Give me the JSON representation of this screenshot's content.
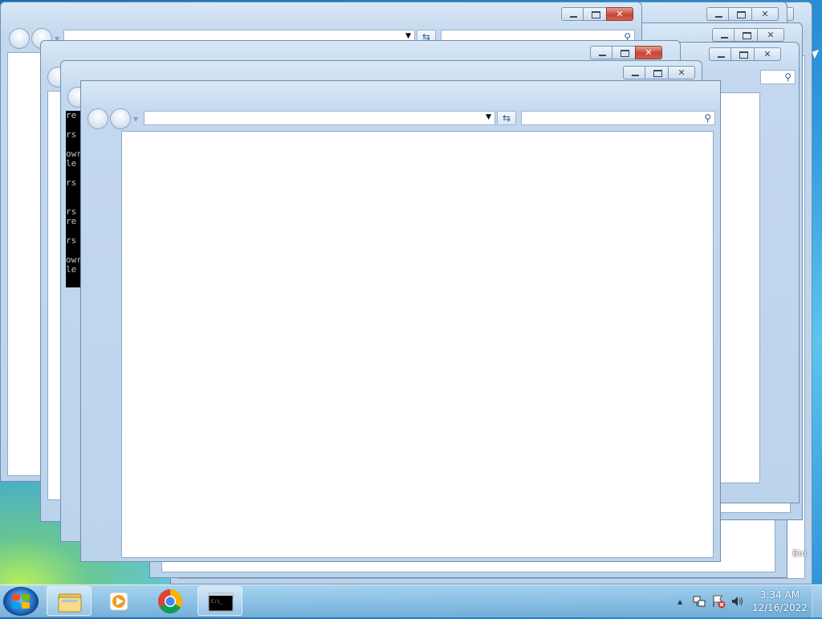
{
  "desktop": {
    "recycle_bin_label": "Bin"
  },
  "console": {
    "lines": [
      "re",
      "",
      "rs vmi",
      "",
      "owr ",
      "le pro",
      "",
      "rs vmi",
      "",
      "",
      "rs vmi",
      "re .ex",
      "",
      "rs vmi",
      "",
      "owr ",
      "le pro"
    ]
  },
  "taskbar": {
    "start_button": "windows-orb",
    "pinned": [
      {
        "name": "windows-explorer",
        "icon": "folder-icon"
      },
      {
        "name": "windows-media-player",
        "icon": "media-player-icon"
      },
      {
        "name": "google-chrome",
        "icon": "chrome-icon"
      },
      {
        "name": "command-prompt",
        "icon": "cmd-icon",
        "active": true
      }
    ],
    "tray": {
      "show_hidden_icons": "▲",
      "clock_time": "3:34 AM",
      "clock_date": "12/16/2022"
    }
  },
  "windows": [
    {
      "name": "explorer-window-1"
    },
    {
      "name": "explorer-window-2"
    },
    {
      "name": "explorer-window-3"
    },
    {
      "name": "explorer-window-4"
    },
    {
      "name": "explorer-window-5"
    },
    {
      "name": "explorer-window-6"
    },
    {
      "name": "explorer-window-7"
    }
  ],
  "colors": {
    "close_button_red": "#c74533",
    "window_frame": "#c3d8ee",
    "desktop_blue": "#2f97dc"
  }
}
